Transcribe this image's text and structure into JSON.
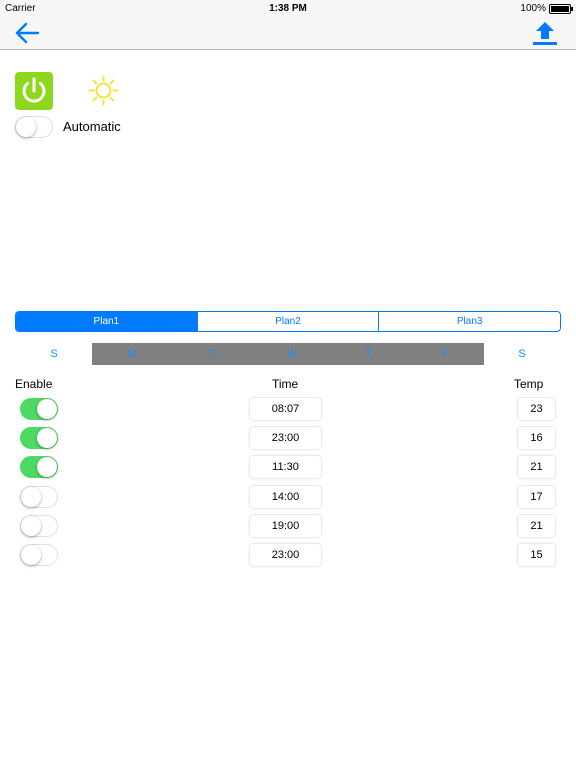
{
  "status_bar": {
    "carrier": "Carrier",
    "time": "1:38 PM",
    "battery": "100%"
  },
  "nav": {
    "back_icon": "back-arrow-icon",
    "upload_icon": "upload-arrow-icon"
  },
  "controls": {
    "power_icon": "power-icon",
    "sun_icon": "sun-icon",
    "automatic_label": "Automatic",
    "automatic_on": false
  },
  "plans": {
    "selected": 0,
    "tabs": [
      {
        "label": "Plan1"
      },
      {
        "label": "Plan2"
      },
      {
        "label": "Plan3"
      }
    ]
  },
  "days": [
    "S",
    "M",
    "T",
    "W",
    "T",
    "F",
    "S"
  ],
  "table": {
    "headers": {
      "enable": "Enable",
      "time": "Time",
      "temp": "Temp"
    },
    "rows": [
      {
        "enabled": true,
        "time": "08:07",
        "temp": "23"
      },
      {
        "enabled": true,
        "time": "23:00",
        "temp": "16"
      },
      {
        "enabled": true,
        "time": "11:30",
        "temp": "21"
      },
      {
        "enabled": false,
        "time": "14:00",
        "temp": "17"
      },
      {
        "enabled": false,
        "time": "19:00",
        "temp": "21"
      },
      {
        "enabled": false,
        "time": "23:00",
        "temp": "15"
      }
    ]
  },
  "colors": {
    "accent": "#007aff",
    "switch_on": "#4cd964",
    "power_bg": "#8ed81c",
    "sun": "#f5e43a",
    "weekday_band": "#808080"
  }
}
